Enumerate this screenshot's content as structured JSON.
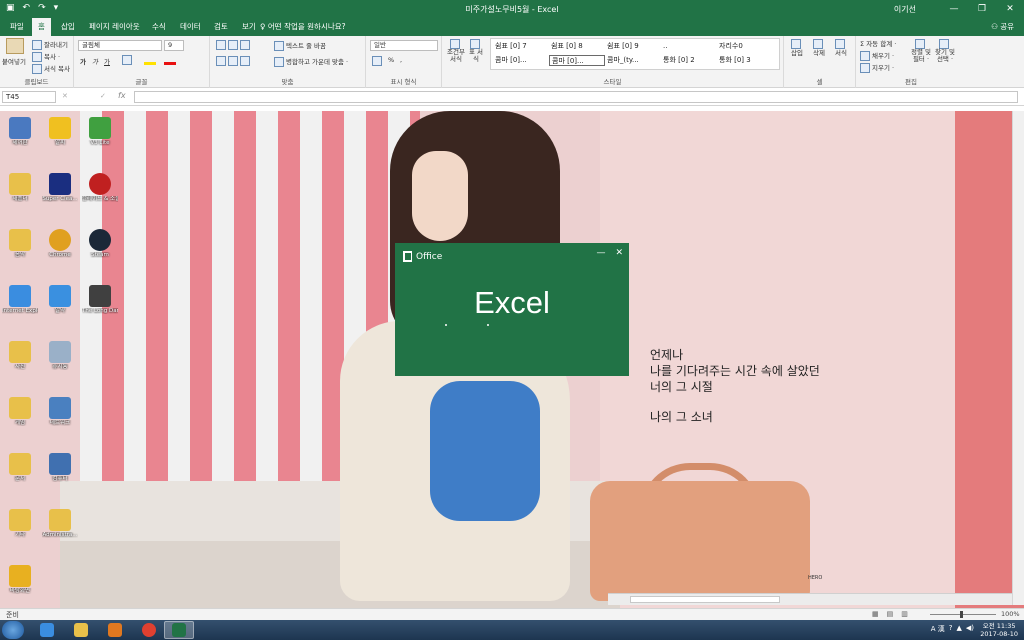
{
  "window": {
    "title": "미주가설노무비5월 - Excel",
    "user": "이기선",
    "share": "공유",
    "controls": {
      "min": "—",
      "max": "❐",
      "close": "✕"
    }
  },
  "qat": {
    "save": "▣",
    "undo": "↶",
    "redo": "↷",
    "more": "▾"
  },
  "tabs": [
    "파일",
    "홈",
    "삽입",
    "페이지 레이아웃",
    "수식",
    "데이터",
    "검토",
    "보기"
  ],
  "tell_me": "어떤 작업을 원하시나요?",
  "ribbon": {
    "clipboard": {
      "label": "클립보드",
      "paste": "붙여넣기",
      "cut": "잘라내기",
      "copy": "복사 ·",
      "format_painter": "서식 복사"
    },
    "font": {
      "label": "글꼴",
      "name": "굴림체",
      "size": "9",
      "bold": "가",
      "italic": "가",
      "underline": "가"
    },
    "alignment": {
      "label": "맞춤",
      "wrap": "텍스트 줄 바꿈",
      "merge": "병합하고 가운데 맞춤 ·"
    },
    "number": {
      "label": "표시 형식",
      "format": "일반",
      "percent": "%",
      "comma": ","
    },
    "styles": {
      "label": "스타일",
      "conditional": "조건부 서식",
      "table": "표 서식",
      "cells": [
        "쉼표 [0] 7",
        "쉼표 [0] 8",
        "쉼표 [0] 9",
        "..",
        "자리수0",
        "콤마 [0]...",
        "콤마 [0]...",
        "콤마_(ty...",
        "통화 [0] 2",
        "통화 [0] 3"
      ]
    },
    "cells": {
      "label": "셀",
      "insert": "삽입",
      "delete": "삭제",
      "format": "서식"
    },
    "editing": {
      "label": "편집",
      "autosum": "자동 합계 ·",
      "fill": "채우기 ·",
      "clear": "지우기 ·",
      "sort": "정렬 및 필터 ·",
      "find": "찾기 및 선택 ·"
    }
  },
  "formula_bar": {
    "name_box": "T45",
    "fx": "fx",
    "cancel": "✕",
    "enter": "✓",
    "value": ""
  },
  "desktop_icons": [
    {
      "label": "제어판",
      "color": "#4a79c0"
    },
    {
      "label": "새폴더",
      "color": "#e8c04a"
    },
    {
      "label": "음악",
      "color": "#e8c04a"
    },
    {
      "label": "Internet Explorer",
      "color": "#3a8de0"
    },
    {
      "label": "사진",
      "color": "#e8c04a"
    },
    {
      "label": "게임",
      "color": "#e8c04a"
    },
    {
      "label": "문서",
      "color": "#e8c04a"
    },
    {
      "label": "기타",
      "color": "#e8c04a"
    },
    {
      "label": "바탕화면",
      "color": "#e8b020"
    },
    {
      "label": "알씨",
      "color": "#f0c020"
    },
    {
      "label": "Super Clea...",
      "color": "#1a2e80"
    },
    {
      "label": "Chrome",
      "color": "#e0a020"
    },
    {
      "label": "알약",
      "color": "#3a90e0"
    },
    {
      "label": "휴지통",
      "color": "#9ab0c8"
    },
    {
      "label": "네트워크",
      "color": "#4a80c0"
    },
    {
      "label": "컴퓨터",
      "color": "#4070b0"
    },
    {
      "label": "Administra...",
      "color": "#e8c04a"
    },
    {
      "label": "V3 Lite",
      "color": "#40a040"
    },
    {
      "label": "블레이드 & 소울",
      "color": "#c02020"
    },
    {
      "label": "Steam",
      "color": "#1b2838"
    },
    {
      "label": "The Long Dark",
      "color": "#404040"
    }
  ],
  "lyrics": [
    "언제나",
    "나를 기다려주는 시간 속에 살았던",
    "너의 그 시절",
    "나의 그 소녀"
  ],
  "photo_tag": "HERO",
  "splash": {
    "brand": "Office",
    "app": "Excel",
    "min": "—",
    "close": "✕"
  },
  "status": {
    "ready": "준비",
    "zoom": "100%"
  },
  "taskbar": {
    "time": "오전 11:35",
    "date": "2017-08-10",
    "ime": "A 漢",
    "apps": [
      {
        "name": "ie",
        "color": "#3a8de0"
      },
      {
        "name": "explorer",
        "color": "#e8c04a"
      },
      {
        "name": "media",
        "color": "#e07820"
      },
      {
        "name": "chrome",
        "color": "#e04030"
      },
      {
        "name": "excel",
        "color": "#217346"
      }
    ]
  },
  "colors": {
    "excel_green": "#217346",
    "ribbon_bg": "#f3f3f3"
  }
}
